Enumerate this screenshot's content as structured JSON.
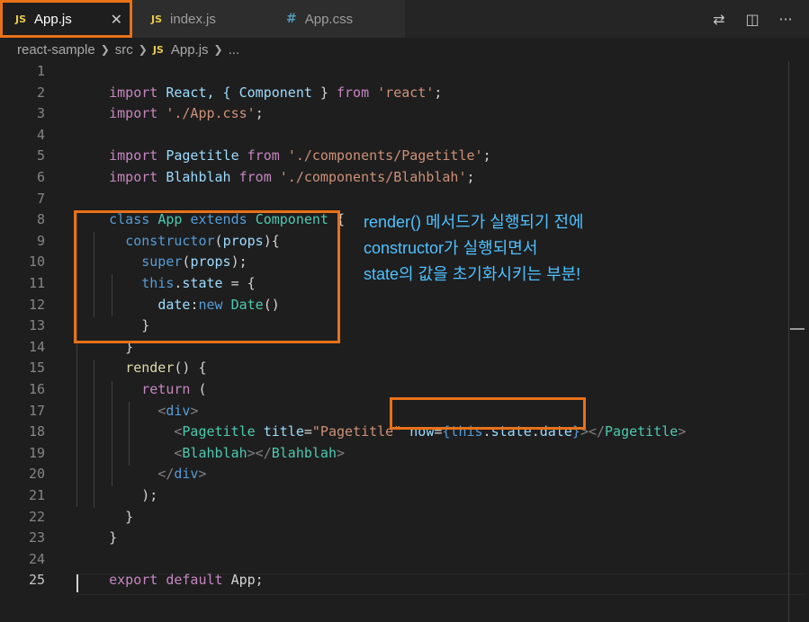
{
  "tabs": [
    {
      "icon": "JS",
      "label": "App.js",
      "close": "✕"
    },
    {
      "icon": "JS",
      "label": "index.js"
    },
    {
      "icon": "#",
      "label": "App.css"
    }
  ],
  "tab_actions": {
    "compare": "⇄",
    "split": "◫",
    "more": "···"
  },
  "breadcrumb": {
    "project": "react-sample",
    "folder": "src",
    "file_icon": "JS",
    "file": "App.js",
    "more": "..."
  },
  "line_numbers": [
    "1",
    "2",
    "3",
    "4",
    "5",
    "6",
    "7",
    "8",
    "9",
    "10",
    "11",
    "12",
    "13",
    "14",
    "15",
    "16",
    "17",
    "18",
    "19",
    "20",
    "21",
    "22",
    "23",
    "24",
    "25"
  ],
  "code": {
    "l1": [
      "import",
      " React, { ",
      "Component",
      " } ",
      "from",
      " ",
      "'react'",
      ";"
    ],
    "l2": [
      "import",
      " ",
      "'./App.css'",
      ";"
    ],
    "l4": [
      "import",
      " Pagetitle ",
      "from",
      " ",
      "'./components/Pagetitle'",
      ";"
    ],
    "l5": [
      "import",
      " Blahblah ",
      "from",
      " ",
      "'./components/Blahblah'",
      ";"
    ],
    "l7": [
      "class",
      " ",
      "App",
      " ",
      "extends",
      " ",
      "Component",
      " {"
    ],
    "l8": [
      "  ",
      "constructor",
      "(",
      "props",
      "){"
    ],
    "l9": [
      "    ",
      "super",
      "(",
      "props",
      ");"
    ],
    "l10": [
      "    ",
      "this",
      ".",
      "state",
      " = {"
    ],
    "l11": [
      "      ",
      "date",
      ":",
      "new",
      " ",
      "Date",
      "()"
    ],
    "l12": [
      "    }"
    ],
    "l13": [
      "  }"
    ],
    "l14": [
      "  ",
      "render",
      "() {"
    ],
    "l15": [
      "    ",
      "return",
      " ("
    ],
    "l16": [
      "      ",
      "<",
      "div",
      ">"
    ],
    "l17": [
      "        ",
      "<",
      "Pagetitle",
      " ",
      "title",
      "=",
      "\"Pagetitle\"",
      " ",
      "now",
      "=",
      "{",
      "this",
      ".",
      "state",
      ".",
      "date",
      "}",
      "></",
      "Pagetitle",
      ">"
    ],
    "l18": [
      "        ",
      "<",
      "Blahblah",
      "></",
      "Blahblah",
      ">"
    ],
    "l19": [
      "      ",
      "</",
      "div",
      ">"
    ],
    "l20": [
      "    );"
    ],
    "l21": [
      "  }"
    ],
    "l22": [
      "}"
    ],
    "l24": [
      "export",
      " ",
      "default",
      " App;"
    ]
  },
  "annotation": {
    "line1": "render() 메서드가 실행되기 전에",
    "line2": "constructor가 실행되면서",
    "line3": "state의 값을 초기화시키는 부분!"
  },
  "colors": {
    "highlight_border": "#e8711a",
    "annotation_text": "#4fc1ff",
    "js_icon": "#e8c94b",
    "css_icon": "#519aba"
  }
}
